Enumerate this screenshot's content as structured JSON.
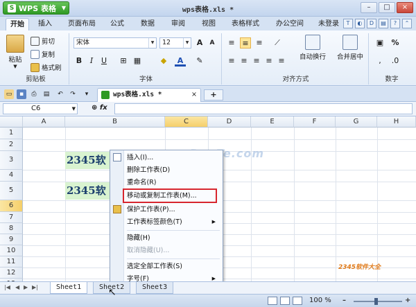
{
  "app": {
    "button_label": "WPS 表格",
    "window_title": "wps表格.xls *",
    "window_controls": [
      "–",
      "□",
      "×"
    ]
  },
  "menu": {
    "tabs": [
      "开始",
      "插入",
      "页面布局",
      "公式",
      "数据",
      "审阅",
      "视图",
      "表格样式",
      "办公空间"
    ],
    "active_tab": "开始",
    "login": "未登录"
  },
  "ribbon": {
    "clipboard": {
      "paste": "粘贴",
      "cut": "剪切",
      "copy": "复制",
      "format_painter": "格式刷",
      "group_label": "剪贴板"
    },
    "font": {
      "font_name": "宋体",
      "font_size": "12",
      "bold": "B",
      "italic": "I",
      "underline": "U",
      "group_label": "字体"
    },
    "alignment": {
      "wrap_text": "自动换行",
      "merge_center": "合并居中",
      "group_label": "对齐方式"
    },
    "number": {
      "percent": "%",
      "group_label": "数字"
    }
  },
  "document_tab": {
    "label": "wps表格.xls *",
    "close": "×",
    "new": "+"
  },
  "formula_bar": {
    "cell_ref": "C6",
    "fx": "fx",
    "zoom_icon": "⊕"
  },
  "grid": {
    "columns": [
      "A",
      "B",
      "C",
      "D",
      "E",
      "F",
      "G",
      "H"
    ],
    "selected_column": "C",
    "rows": [
      "1",
      "2",
      "3",
      "4",
      "5",
      "6",
      "7",
      "8",
      "9",
      "10",
      "11",
      "12",
      "13"
    ],
    "selected_row": "6",
    "cells": [
      {
        "ref": "B3",
        "text": "2345软"
      },
      {
        "ref": "B5",
        "text": "2345软"
      }
    ],
    "watermark": "www.DuoTe.com"
  },
  "context_menu": {
    "items": [
      {
        "label": "插入(I)...",
        "disabled": false,
        "submenu": false
      },
      {
        "label": "删除工作表(D)",
        "disabled": false,
        "submenu": false
      },
      {
        "label": "重命名(R)",
        "disabled": false,
        "submenu": false
      },
      {
        "label": "移动或复制工作表(M)...",
        "disabled": false,
        "submenu": false,
        "highlighted": true
      },
      {
        "label": "保护工作表(P)...",
        "disabled": false,
        "submenu": false
      },
      {
        "label": "工作表标签颜色(T)",
        "disabled": false,
        "submenu": true
      },
      {
        "label": "隐藏(H)",
        "disabled": false,
        "submenu": false
      },
      {
        "label": "取消隐藏(U)...",
        "disabled": true,
        "submenu": false
      },
      {
        "label": "选定全部工作表(S)",
        "disabled": false,
        "submenu": false
      },
      {
        "label": "字号(F)",
        "disabled": false,
        "submenu": true
      }
    ]
  },
  "sheet_tabs": [
    "Sheet1",
    "Sheet2",
    "Sheet3"
  ],
  "status": {
    "zoom": "100 %",
    "minus": "–",
    "plus": "+"
  },
  "colors": {
    "accent_green": "#2f9a24",
    "highlight_red": "#d7262e",
    "selection": "#f5cf6a"
  }
}
